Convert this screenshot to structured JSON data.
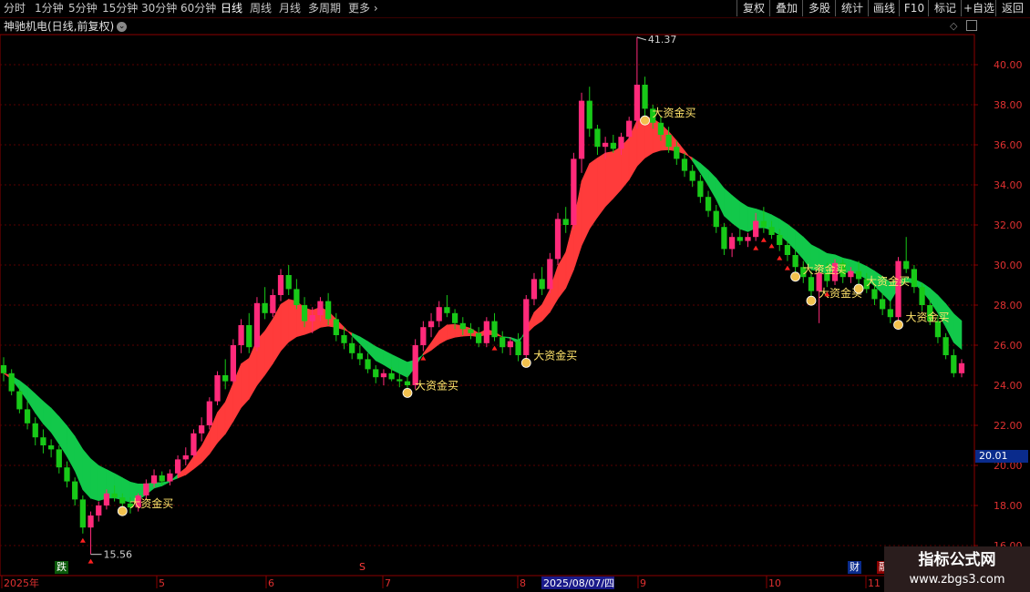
{
  "toolbar": {
    "periods": [
      "分时",
      "1分钟",
      "5分钟",
      "15分钟",
      "30分钟",
      "60分钟",
      "日线",
      "周线",
      "月线",
      "多周期",
      "更多"
    ],
    "active_period": "日线",
    "right_buttons": [
      "复权",
      "叠加",
      "多股",
      "统计",
      "画线",
      "F10",
      "标记",
      "+自选",
      "返回"
    ]
  },
  "title": "神驰机电(日线,前复权)",
  "price_labels": [
    "40.00",
    "38.00",
    "36.00",
    "34.00",
    "32.00",
    "30.00",
    "28.00",
    "26.00",
    "24.00",
    "22.00",
    "20.00",
    "18.00",
    "16.00"
  ],
  "current_price": "20.01",
  "high_label": "41.37",
  "low_label": "15.56",
  "signal_text": "大资金买",
  "date_labels": [
    "2025年",
    "5",
    "6",
    "7",
    "8",
    "2025/08/07/四",
    "9",
    "10",
    "11"
  ],
  "bottom_tags": {
    "down": "跌",
    "s": "S",
    "cai": "财",
    "rong": "融"
  },
  "watermark": {
    "line1": "指标公式网",
    "line2": "www.zbgs3.com"
  },
  "colors": {
    "up": "#ff2a7a",
    "down": "#18c918",
    "band_up": "#ff3b3b",
    "band_down": "#12c84a",
    "grid": "#5a0000",
    "axis": "#8b0000"
  }
}
